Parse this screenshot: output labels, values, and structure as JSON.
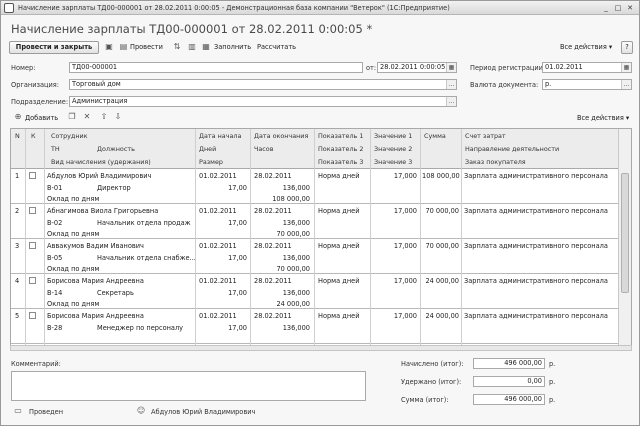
{
  "window": {
    "title": "Начисление зарплаты ТД00-000001 от 28.02.2011 0:00:05 - Демонстрационная база компании \"Ветерок\" (1С:Предприятие)",
    "controls": [
      "minimize-icon",
      "maximize-icon",
      "close-icon"
    ]
  },
  "heading": "Начисление зарплаты ТД00-000001 от 28.02.2011 0:00:05 *",
  "toolbar": {
    "post_close": "Провести и закрыть",
    "post": "Провести",
    "fill": "Заполнить",
    "calculate": "Рассчитать",
    "all_actions": "Все действия ▾",
    "help": "?"
  },
  "form": {
    "number_label": "Номер:",
    "number_value": "ТД00-000001",
    "date_label": "от:",
    "date_value": "28.02.2011  0:00:05",
    "period_label": "Период регистрации:",
    "period_value": "01.02.2011",
    "org_label": "Организация:",
    "org_value": "Торговый дом",
    "currency_label": "Валюта документа:",
    "currency_value": "р.",
    "dept_label": "Подразделение:",
    "dept_value": "Администрация"
  },
  "table_toolbar": {
    "add": "Добавить",
    "all_actions": "Все действия ▾"
  },
  "table": {
    "headers": {
      "n": "N",
      "k": "К",
      "employee": "Сотрудник",
      "tn": "ТН",
      "position": "Должность",
      "accrual_type": "Вид начисления (удержания)",
      "date_start": "Дата начала",
      "days": "Дней",
      "size": "Размер",
      "date_end": "Дата окончания",
      "hours": "Часов",
      "ind1": "Показатель 1",
      "ind2": "Показатель 2",
      "ind3": "Показатель 3",
      "val1": "Значение 1",
      "val2": "Значение 2",
      "val3": "Значение 3",
      "sum": "Сумма",
      "account": "Счет затрат",
      "direction": "Направление деятельности",
      "customer": "Заказ покупателя"
    },
    "rows": [
      {
        "n": "1",
        "employee": "Абдулов Юрий Владимирович",
        "tn": "В-01",
        "position": "Директор",
        "accrual": "Оклад по дням",
        "date_start": "01.02.2011",
        "days": "17,00",
        "date_end": "28.02.2011",
        "hours": "136,000",
        "size": "108 000,00",
        "ind1": "Норма дней",
        "val1": "17,000",
        "sum": "108 000,00",
        "account": "Зарплата административного персонала"
      },
      {
        "n": "2",
        "employee": "Абнагимова Виола Григорьевна",
        "tn": "В-02",
        "position": "Начальник отдела продаж",
        "accrual": "Оклад по дням",
        "date_start": "01.02.2011",
        "days": "17,00",
        "date_end": "28.02.2011",
        "hours": "136,000",
        "size": "70 000,00",
        "ind1": "Норма дней",
        "val1": "17,000",
        "sum": "70 000,00",
        "account": "Зарплата административного персонала"
      },
      {
        "n": "3",
        "employee": "Аввакумов Вадим Иванович",
        "tn": "В-05",
        "position": "Начальник отдела снабже...",
        "accrual": "Оклад по дням",
        "date_start": "01.02.2011",
        "days": "17,00",
        "date_end": "28.02.2011",
        "hours": "136,000",
        "size": "70 000,00",
        "ind1": "Норма дней",
        "val1": "17,000",
        "sum": "70 000,00",
        "account": "Зарплата административного персонала"
      },
      {
        "n": "4",
        "employee": "Борисова Мария Андреевна",
        "tn": "В-14",
        "position": "Секретарь",
        "accrual": "Оклад по дням",
        "date_start": "01.02.2011",
        "days": "17,00",
        "date_end": "28.02.2011",
        "hours": "136,000",
        "size": "24 000,00",
        "ind1": "Норма дней",
        "val1": "17,000",
        "sum": "24 000,00",
        "account": "Зарплата административного персонала"
      },
      {
        "n": "5",
        "employee": "Борисова Мария Андреевна",
        "tn": "В-28",
        "position": "Менеджер по персоналу",
        "accrual": "",
        "date_start": "01.02.2011",
        "days": "17,00",
        "date_end": "28.02.2011",
        "hours": "136,000",
        "size": "",
        "ind1": "Норма дней",
        "val1": "17,000",
        "sum": "24 000,00",
        "account": "Зарплата административного персонала"
      }
    ]
  },
  "totals": {
    "accrued_label": "Начислено (итог):",
    "accrued_value": "496 000,00",
    "withheld_label": "Удержано (итог):",
    "withheld_value": "0,00",
    "sum_label": "Сумма (итог):",
    "sum_value": "496 000,00",
    "currency": "р."
  },
  "comment_label": "Комментарий:",
  "status": {
    "state": "Проведен",
    "author": "Абдулов Юрий Владимирович"
  }
}
